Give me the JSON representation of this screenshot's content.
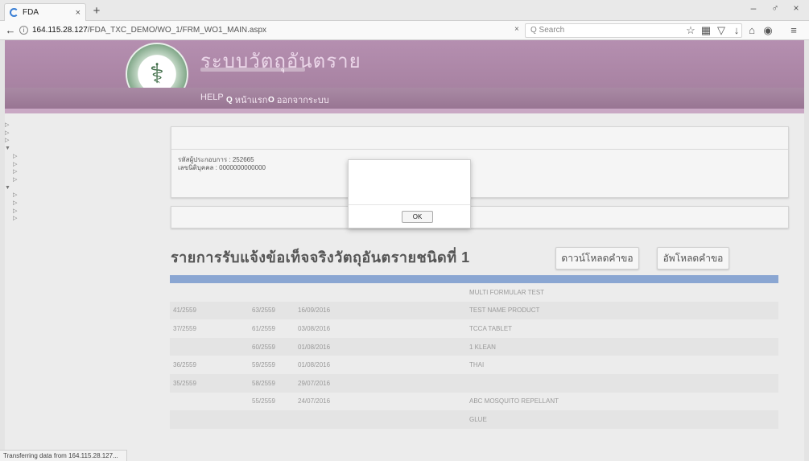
{
  "browser": {
    "tab_title": "FDA",
    "tab_close": "×",
    "new_tab": "+",
    "url_host": "164.115.28.127",
    "url_path": "/FDA_TXC_DEMO/WO_1/FRM_WO1_MAIN.aspx",
    "url_clear": "×",
    "search_placeholder": "Q Search",
    "window_controls": [
      "–",
      "♂",
      "×"
    ],
    "toolbar_icons": [
      "star-icon",
      "library-icon",
      "pocket-icon",
      "download-icon",
      "home-icon",
      "account-icon",
      "menu-icon"
    ],
    "status_text": "Transferring data from 164.115.28.127..."
  },
  "header": {
    "app_title": "ระบบวัตถุอันตราย",
    "menu": {
      "help": "HELP",
      "home": "หน้าแรก",
      "logout": "ออกจากระบบ"
    },
    "user_name": ""
  },
  "sidebar": {
    "items": [
      {
        "label": "",
        "level": 1,
        "arrow": "▷"
      },
      {
        "label": "",
        "level": 1,
        "arrow": "▷"
      },
      {
        "label": "",
        "level": 1,
        "arrow": "▷"
      },
      {
        "label": "",
        "level": 1,
        "arrow": "▼"
      },
      {
        "label": "",
        "level": 2,
        "arrow": "▷"
      },
      {
        "label": "",
        "level": 2,
        "arrow": "▷"
      },
      {
        "label": "",
        "level": 2,
        "arrow": "▷"
      },
      {
        "label": "",
        "level": 2,
        "arrow": "▷"
      },
      {
        "label": "",
        "level": 1,
        "arrow": "▼"
      },
      {
        "label": "",
        "level": 2,
        "arrow": "▷"
      },
      {
        "label": "",
        "level": 2,
        "arrow": "▷"
      },
      {
        "label": "",
        "level": 2,
        "arrow": "▷"
      },
      {
        "label": "",
        "level": 2,
        "arrow": "▷"
      }
    ]
  },
  "company_panel": {
    "company_name": "",
    "line1": "รหัสผู้ประกอบการ : 252665",
    "line2": "เลขนิติบุคคล : 0000000000000",
    "line3_left": "",
    "line3_right": ""
  },
  "status_panel": {
    "label": ""
  },
  "list": {
    "title": "รายการรับแจ้งข้อเท็จจริงวัตถุอันตรายชนิดที่ 1",
    "download_button": "ดาวน์โหลดคำขอ",
    "upload_button": "อัพโหลดคำขอ"
  },
  "table": {
    "headers": [
      "",
      "",
      "",
      "",
      "",
      "",
      ""
    ],
    "rows": [
      [
        "",
        "",
        "",
        "",
        "MULTI FORMULAR TEST",
        "",
        ""
      ],
      [
        "41/2559",
        "63/2559",
        "16/09/2016",
        "",
        "TEST NAME PRODUCT",
        "",
        ""
      ],
      [
        "37/2559",
        "61/2559",
        "03/08/2016",
        "",
        "TCCA TABLET",
        "",
        ""
      ],
      [
        "",
        "60/2559",
        "01/08/2016",
        "",
        "1 KLEAN",
        "",
        ""
      ],
      [
        "36/2559",
        "59/2559",
        "01/08/2016",
        "",
        "THAI",
        "",
        ""
      ],
      [
        "35/2559",
        "58/2559",
        "29/07/2016",
        "",
        "",
        "",
        ""
      ],
      [
        "",
        "55/2559",
        "24/07/2016",
        "",
        "ABC MOSQUITO REPELLANT",
        "",
        ""
      ],
      [
        "",
        "",
        "",
        "",
        "GLUE",
        "",
        ""
      ]
    ]
  },
  "dialog": {
    "message": "",
    "ok_label": "OK"
  }
}
